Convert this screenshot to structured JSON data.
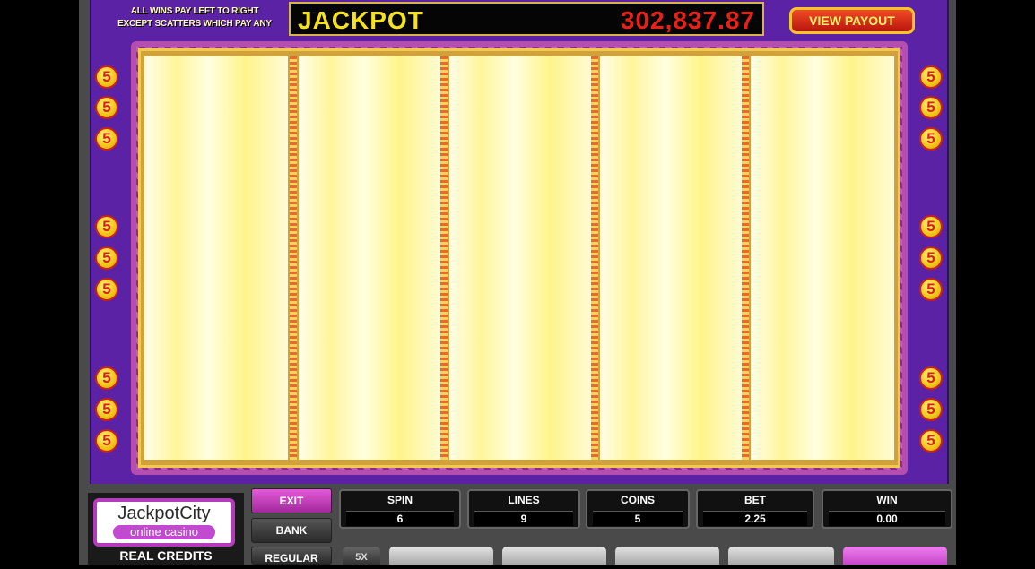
{
  "header": {
    "rules_line1": "ALL WINS PAY LEFT TO RIGHT",
    "rules_line2": "EXCEPT SCATTERS WHICH PAY ANY",
    "jackpot_label": "JACKPOT",
    "jackpot_value": "302,837.87",
    "view_payout_label": "VIEW PAYOUT"
  },
  "paylines": {
    "marker": "5",
    "left": [
      "5",
      "5",
      "5",
      "5",
      "5",
      "5",
      "5",
      "5",
      "5"
    ],
    "right": [
      "5",
      "5",
      "5",
      "5",
      "5",
      "5",
      "5",
      "5",
      "5"
    ]
  },
  "brand": {
    "name": "JackpotCity",
    "tagline": "online casino",
    "mode": "REAL CREDITS"
  },
  "controls": {
    "exit_label": "EXIT",
    "bank_label": "BANK",
    "regular_label": "REGULAR",
    "multiplier_label": "5X"
  },
  "stats": {
    "spin": {
      "label": "SPIN",
      "value": "6"
    },
    "lines": {
      "label": "LINES",
      "value": "9"
    },
    "coins": {
      "label": "COINS",
      "value": "5"
    },
    "bet": {
      "label": "BET",
      "value": "2.25"
    },
    "win": {
      "label": "WIN",
      "value": "0.00"
    }
  },
  "colors": {
    "cabinet": "#5b22a6",
    "jackpot_text": "#f6e21a",
    "jackpot_value": "#e8201a",
    "exit_button": "#d43fc9"
  }
}
